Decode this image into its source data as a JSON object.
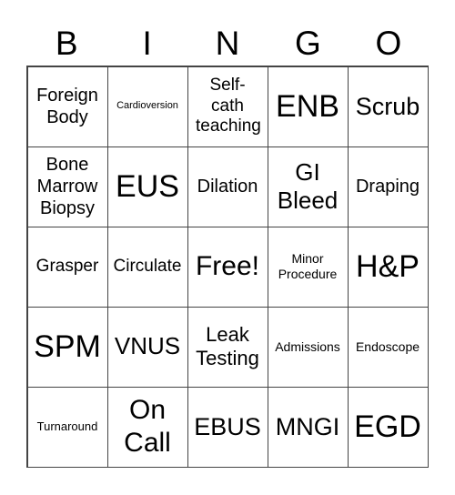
{
  "header": [
    "B",
    "I",
    "N",
    "G",
    "O"
  ],
  "cells": [
    "Foreign Body",
    "Cardioversion",
    "Self-cath teaching",
    "ENB",
    "Scrub",
    "Bone Marrow Biopsy",
    "EUS",
    "Dilation",
    "GI Bleed",
    "Draping",
    "Grasper",
    "Circulate",
    "Free!",
    "Minor Procedure",
    "H&P",
    "SPM",
    "VNUS",
    "Leak Testing",
    "Admissions",
    "Endoscope",
    "Turnaround",
    "On Call",
    "EBUS",
    "MNGI",
    "EGD"
  ]
}
